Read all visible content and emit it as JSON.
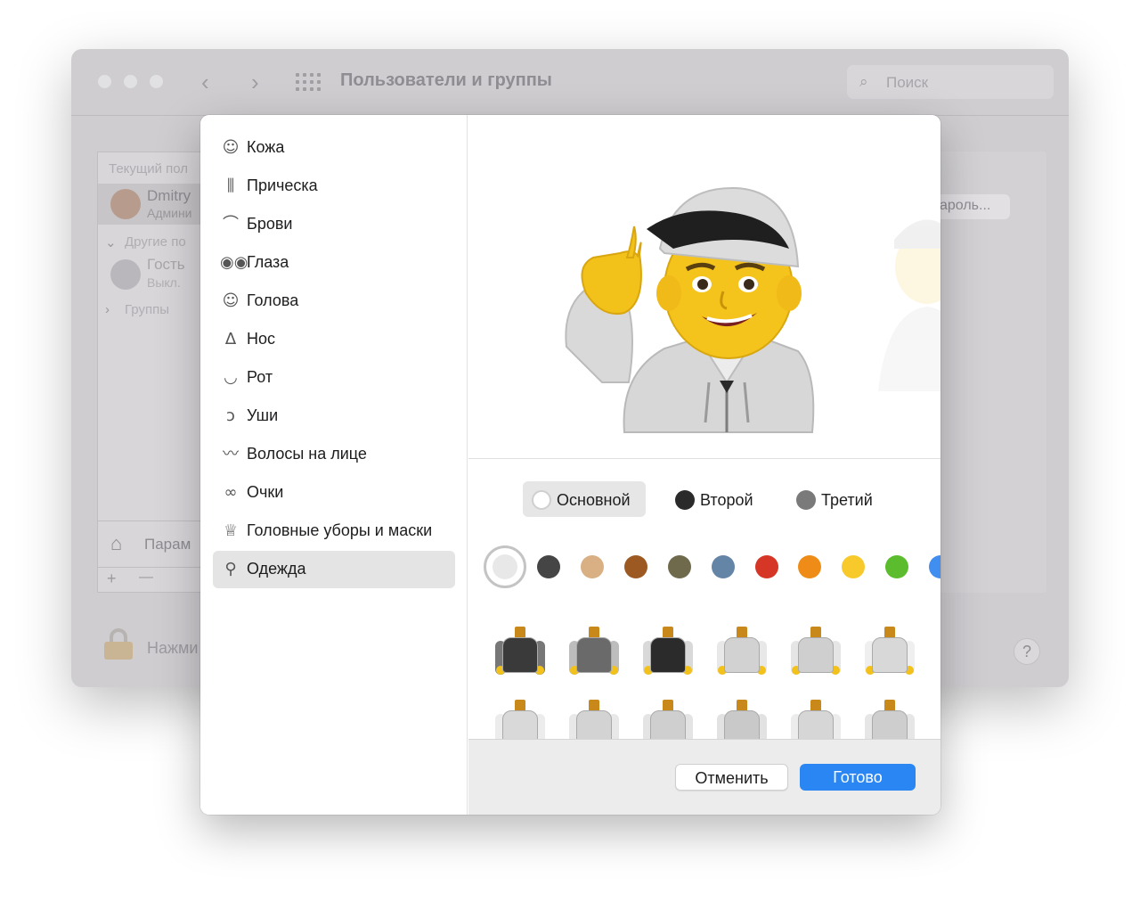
{
  "background_window": {
    "title": "Пользователи и группы",
    "search_placeholder": "Поиск",
    "list_header": "Текущий пол",
    "current_user": {
      "name": "Dmitry",
      "role": "Админи"
    },
    "other_users_header": "Другие по",
    "guest": {
      "name": "Гость",
      "status": "Выкл."
    },
    "groups_label": "Группы",
    "params_label": "Парам",
    "password_button": "ароль...",
    "lock_text": "Нажми",
    "help_label": "?",
    "add_label": "+",
    "remove_label": "—"
  },
  "dialog": {
    "categories": [
      {
        "label": "Кожа",
        "icon": "face-smile-icon",
        "glyph": "☺"
      },
      {
        "label": "Прическа",
        "icon": "comb-icon",
        "glyph": "⫼"
      },
      {
        "label": "Брови",
        "icon": "eyebrow-icon",
        "glyph": "⌒"
      },
      {
        "label": "Глаза",
        "icon": "eyes-icon",
        "glyph": "◉◉"
      },
      {
        "label": "Голова",
        "icon": "head-icon",
        "glyph": "☺"
      },
      {
        "label": "Нос",
        "icon": "nose-icon",
        "glyph": "∆"
      },
      {
        "label": "Рот",
        "icon": "lips-icon",
        "glyph": "◡"
      },
      {
        "label": "Уши",
        "icon": "ear-icon",
        "glyph": "ↄ"
      },
      {
        "label": "Волосы на лице",
        "icon": "mustache-icon",
        "glyph": "〰"
      },
      {
        "label": "Очки",
        "icon": "glasses-icon",
        "glyph": "∞"
      },
      {
        "label": "Головные уборы и маски",
        "icon": "crown-icon",
        "glyph": "♕"
      },
      {
        "label": "Одежда",
        "icon": "walking-person-icon",
        "glyph": "⚲"
      }
    ],
    "selected_category": "Одежда",
    "color_tabs": [
      {
        "label": "Основной",
        "color": "#ffffff",
        "active": true
      },
      {
        "label": "Второй",
        "color": "#2a2a2a",
        "active": false
      },
      {
        "label": "Третий",
        "color": "#7a7a7a",
        "active": false
      }
    ],
    "swatches": [
      "#e8e8e8",
      "#454545",
      "#d9b083",
      "#9c5a22",
      "#6e6a4b",
      "#6585a6",
      "#d63626",
      "#ef8c17",
      "#f7c92b",
      "#5bbd2e",
      "#3f8ef0"
    ],
    "selected_swatch": 0,
    "cancel_label": "Отменить",
    "done_label": "Готово"
  }
}
